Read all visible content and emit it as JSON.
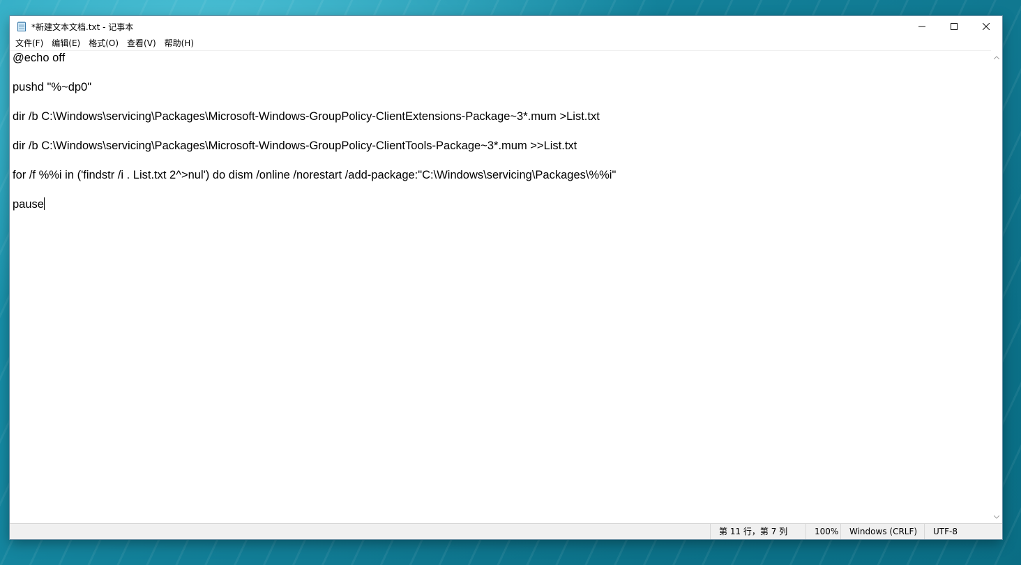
{
  "window": {
    "title": "*新建文本文档.txt - 记事本",
    "icon": "notepad-icon",
    "controls": {
      "minimize": "—",
      "maximize": "☐",
      "close": "✕"
    }
  },
  "menu": [
    {
      "label": "文件(F)"
    },
    {
      "label": "编辑(E)"
    },
    {
      "label": "格式(O)"
    },
    {
      "label": "查看(V)"
    },
    {
      "label": "帮助(H)"
    }
  ],
  "editor": {
    "lines": [
      "@echo off",
      "",
      "pushd \"%~dp0\"",
      "",
      "dir /b C:\\Windows\\servicing\\Packages\\Microsoft-Windows-GroupPolicy-ClientExtensions-Package~3*.mum >List.txt",
      "",
      "dir /b C:\\Windows\\servicing\\Packages\\Microsoft-Windows-GroupPolicy-ClientTools-Package~3*.mum >>List.txt",
      "",
      "for /f %%i in ('findstr /i . List.txt 2^>nul') do dism /online /norestart /add-package:\"C:\\Windows\\servicing\\Packages\\%%i\"",
      "",
      "pause"
    ]
  },
  "status": {
    "position": "第 11 行，第 7 列",
    "zoom": "100%",
    "line_ending": "Windows (CRLF)",
    "encoding": "UTF-8"
  }
}
